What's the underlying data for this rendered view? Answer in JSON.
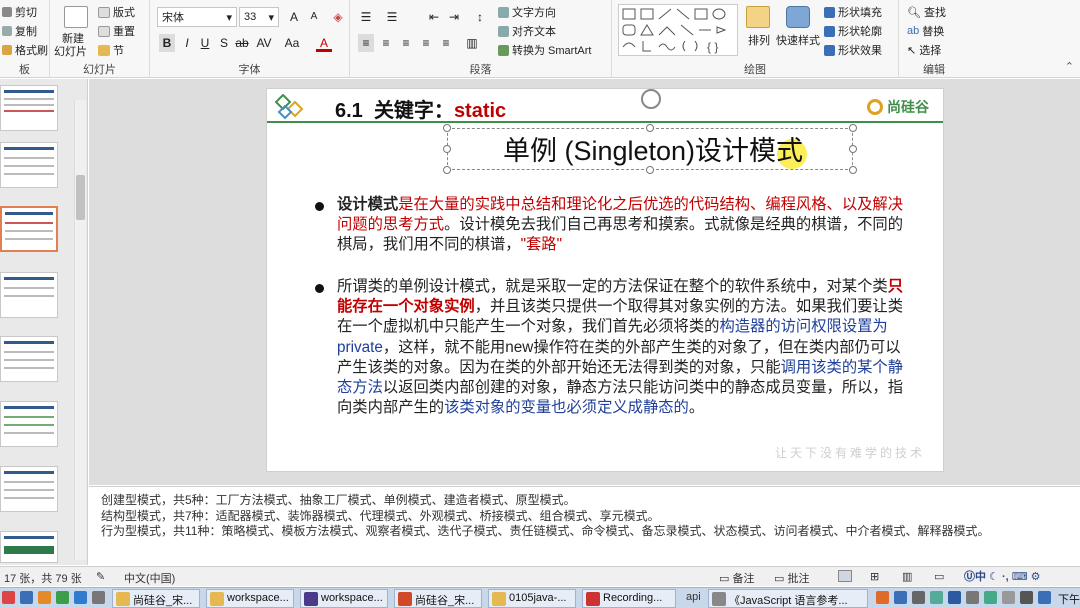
{
  "ribbon": {
    "clipboard": {
      "cut": "剪切",
      "copy": "复制",
      "format_painter": "格式刷",
      "label": "板"
    },
    "slides": {
      "new_slide": "新建",
      "new_slide2": "幻灯片",
      "layout": "版式",
      "reset": "重置",
      "section": "节",
      "label": "幻灯片"
    },
    "font": {
      "family": "宋体",
      "size": "33",
      "label": "字体"
    },
    "paragraph": {
      "label": "段落",
      "text_direction": "文字方向",
      "align_text": "对齐文本",
      "smartart": "转换为 SmartArt"
    },
    "drawing": {
      "label": "绘图",
      "arrange": "排列",
      "quick_styles": "快速样式",
      "shape_fill": "形状填充",
      "shape_outline": "形状轮廓",
      "shape_effects": "形状效果"
    },
    "editing": {
      "label": "编辑",
      "find": "查找",
      "replace": "替换",
      "select": "选择"
    }
  },
  "slide": {
    "section_num": "6.1",
    "section_text": "关键字：",
    "keyword": "static",
    "logo_text": "尚硅谷",
    "subtitle": "单例 (Singleton)设计模式",
    "b1_bold": "设计模式",
    "b1_red": "是在大量的实践中总结和理论化之后优选的代码结构、编程风格、以及解决问题的思考方式",
    "b1_rest": "。设计模免去我们自己再思考和摸索。式就像是经典的棋谱，不同的棋局，我们用不同的棋谱，",
    "b1_red2": "\"套路\"",
    "b2_p1": "所谓类的单例设计模式，就是采取一定的方法保证在整个的软件系统中，对某个类",
    "b2_red": "只能存在一个对象实例",
    "b2_p2": "，并且该类只提供一个取得其对象实例的方法。如果我们要让类在一个虚拟机中只能产生一个对象，我们首先必须将类的",
    "b2_blue1": "构造器的访问权限设置为private",
    "b2_p3": "，这样，就不能用new操作符在类的外部产生类的对象了，但在类内部仍可以产生该类的对象。因为在类的外部开始还无法得到类的对象，只能",
    "b2_blue2": "调用该类的某个静态方法",
    "b2_p4": "以返回类内部创建的对象，静态方法只能访问类中的静态成员变量，所以，指向类内部产生的",
    "b2_blue3": "该类对象的变量也必须定义成静态的",
    "b2_end": "。",
    "watermark": "让天下没有难学的技术"
  },
  "notes": [
    "创建型模式，共5种：工厂方法模式、抽象工厂模式、单例模式、建造者模式、原型模式。",
    "结构型模式，共7种：适配器模式、装饰器模式、代理模式、外观模式、桥接模式、组合模式、享元模式。",
    "行为型模式，共11种：策略模式、模板方法模式、观察者模式、迭代子模式、责任链模式、命令模式、备忘录模式、状态模式、访问者模式、中介者模式、解释器模式。"
  ],
  "status": {
    "slide_count": "17 张，共 79 张",
    "language": "中文(中国)",
    "notes": "备注",
    "comments": "批注"
  },
  "taskbar": {
    "tasks": [
      "尚硅谷_宋...",
      "workspace...",
      "workspace...",
      "尚硅谷_宋...",
      "0105java-...",
      "Recording...",
      "《JavaScript 语言参考..."
    ],
    "api_label": "api",
    "clock": "下午"
  },
  "colors": {
    "accent_red": "#c00000",
    "accent_blue": "#1f3f9a",
    "brand_green": "#3f8f4b",
    "taskbar": "#c9d7ea"
  }
}
